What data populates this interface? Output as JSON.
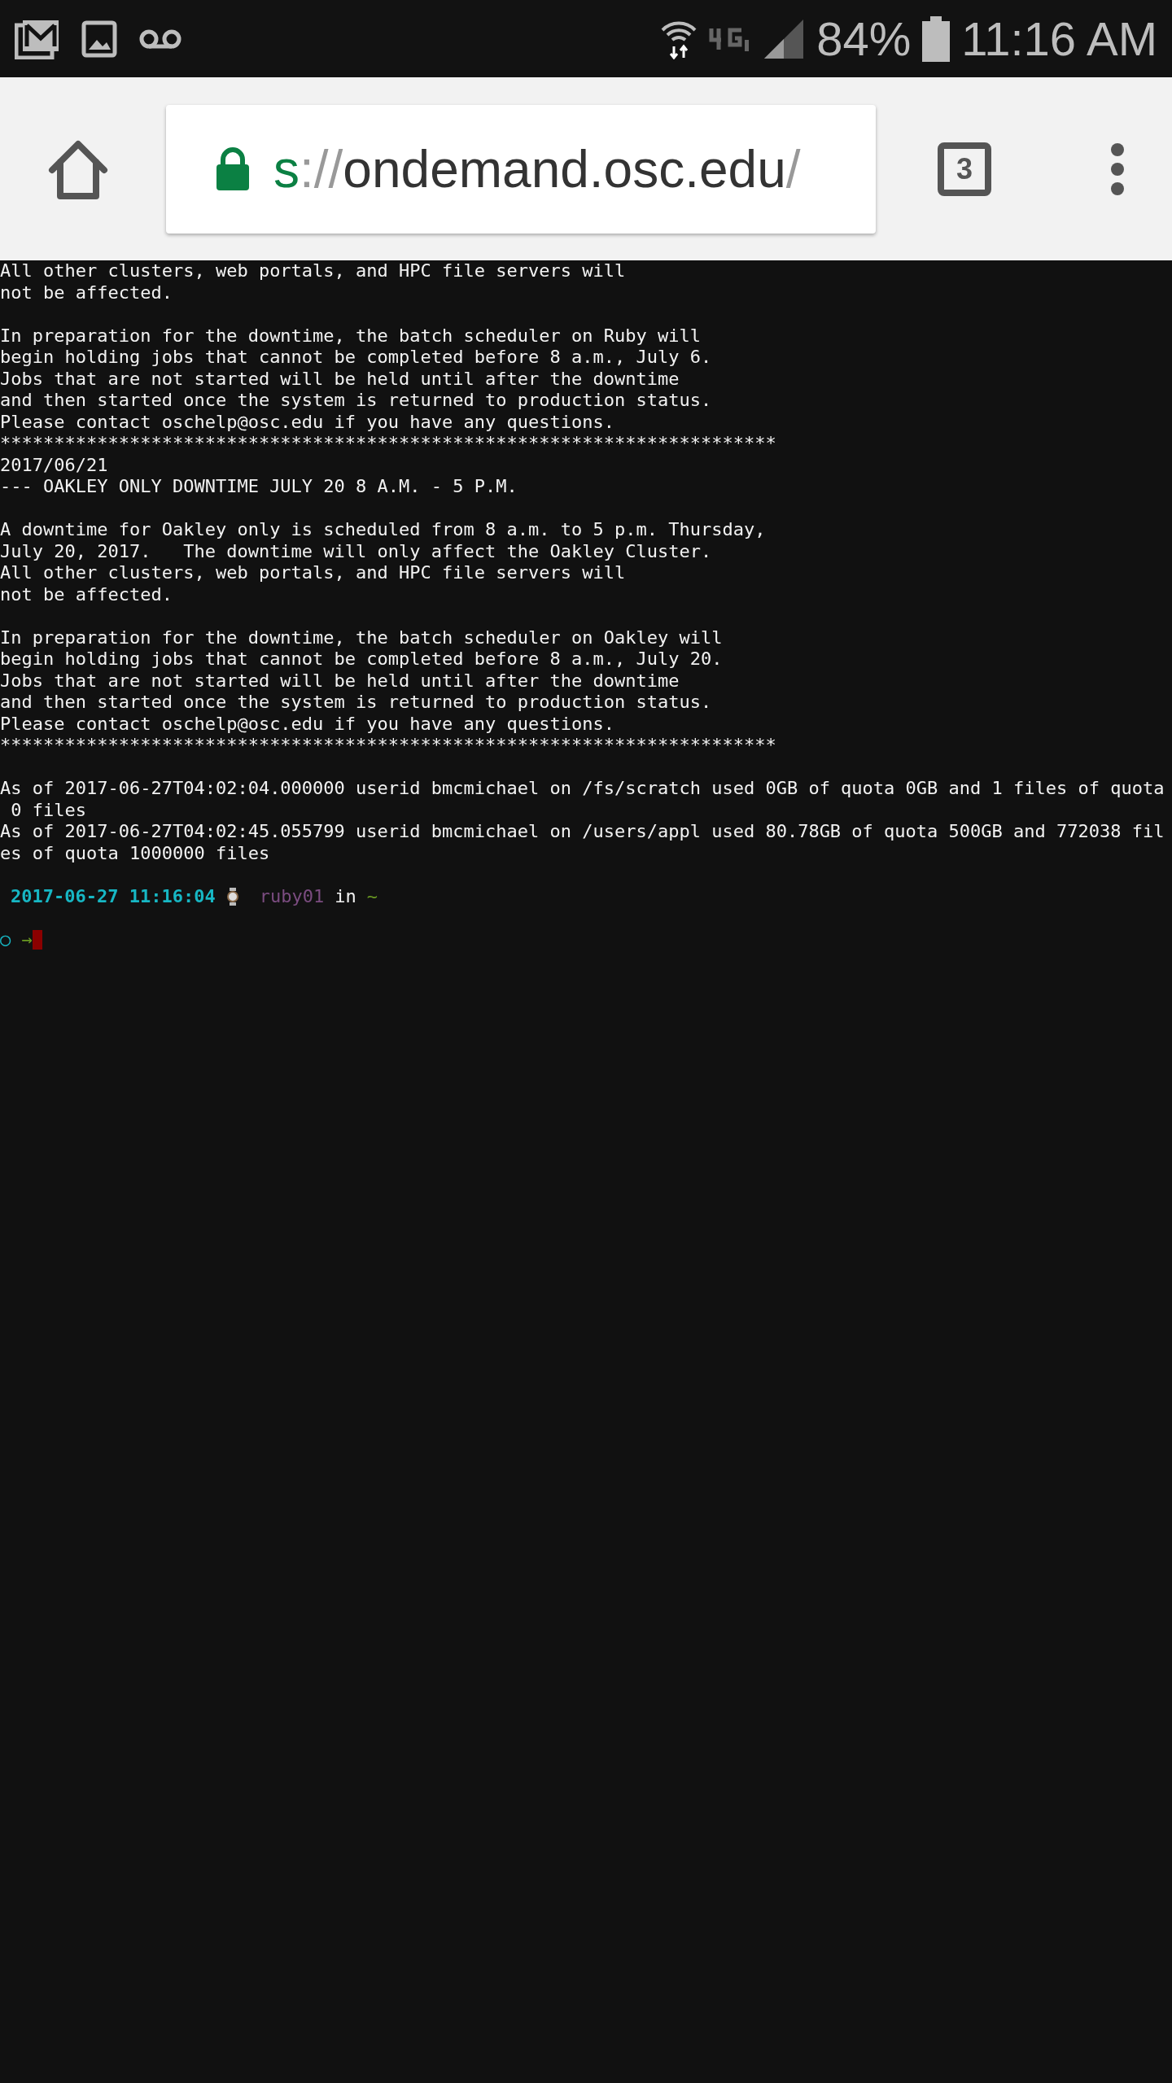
{
  "status_bar": {
    "battery": "84%",
    "time": "11:16 AM"
  },
  "browser": {
    "secure": true,
    "url": {
      "scheme": "s",
      "separator": "://",
      "host": "ondemand.osc.edu",
      "path": "/"
    },
    "tab_count": "3"
  },
  "terminal": {
    "blocks": [
      {
        "lines": [
          "All other clusters, web portals, and HPC file servers will",
          "not be affected."
        ]
      },
      {
        "lines": [
          "In preparation for the downtime, the batch scheduler on Ruby will",
          "begin holding jobs that cannot be completed before 8 a.m., July 6.",
          "Jobs that are not started will be held until after the downtime",
          "and then started once the system is returned to production status.",
          "Please contact oschelp@osc.edu if you have any questions.",
          "************************************************************************",
          "2017/06/21",
          "--- OAKLEY ONLY DOWNTIME JULY 20 8 A.M. - 5 P.M."
        ]
      },
      {
        "lines": [
          "A downtime for Oakley only is scheduled from 8 a.m. to 5 p.m. Thursday,",
          "July 20, 2017.   The downtime will only affect the Oakley Cluster.",
          "All other clusters, web portals, and HPC file servers will",
          "not be affected."
        ]
      },
      {
        "lines": [
          "In preparation for the downtime, the batch scheduler on Oakley will",
          "begin holding jobs that cannot be completed before 8 a.m., July 20.",
          "Jobs that are not started will be held until after the downtime",
          "and then started once the system is returned to production status.",
          "Please contact oschelp@osc.edu if you have any questions.",
          "************************************************************************"
        ]
      },
      {
        "lines": [
          "As of 2017-06-27T04:02:04.000000 userid bmcmichael on /fs/scratch used 0GB of quota 0GB and 1 files of quota",
          " 0 files",
          "As of 2017-06-27T04:02:45.055799 userid bmcmichael on /users/appl used 80.78GB of quota 500GB and 772038 fil",
          "es of quota 1000000 files"
        ]
      }
    ],
    "prompt": {
      "timestamp": "2017-06-27 11:16:04",
      "host": "ruby01",
      "in": "in",
      "dir": "~",
      "status_mark": "○",
      "arrow": "→"
    }
  }
}
